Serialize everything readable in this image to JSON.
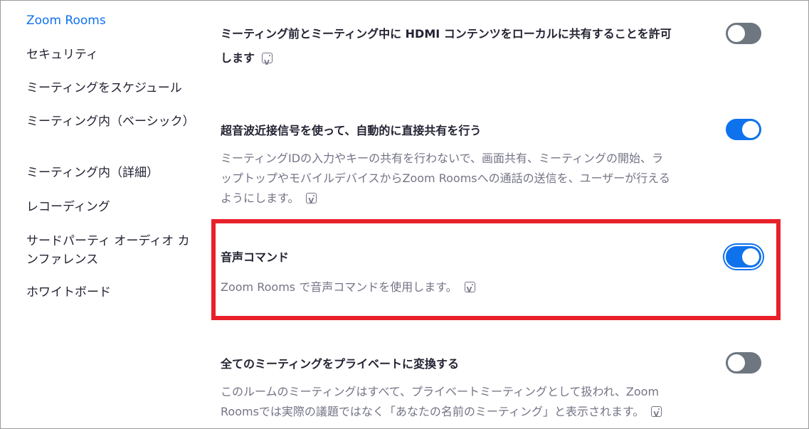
{
  "sidebar": {
    "items": [
      {
        "label": "Zoom Rooms",
        "active": true
      },
      {
        "label": "セキュリティ"
      },
      {
        "label": "ミーティングをスケジュール"
      },
      {
        "label": "ミーティング内（ベーシック）"
      },
      {
        "label": "ミーティング内（詳細）"
      },
      {
        "label": "レコーディング"
      },
      {
        "label": "サードパーティ オーディオ カンファレンス"
      },
      {
        "label": "ホワイトボード"
      }
    ]
  },
  "settings": [
    {
      "title_line1": "ミーティング前とミーティング中に HDMI コンテンツをローカルに共有することを許可",
      "title_line2": "します",
      "enabled": false
    },
    {
      "title": "超音波近接信号を使って、自動的に直接共有を行う",
      "desc_line1": "ミーティングIDの入力やキーの共有を行わないで、画面共有、ミーティングの開始、ラ",
      "desc_line2": "ップトップやモバイルデバイスからZoom Roomsへの通話の送信を、ユーザーが行える",
      "desc_line3": "ようにします。",
      "enabled": true
    },
    {
      "title": "音声コマンド",
      "desc": "Zoom Rooms で音声コマンドを使用します。",
      "enabled": true,
      "highlighted": true
    },
    {
      "title": "全てのミーティングをプライベートに変換する",
      "desc_line1": "このルームのミーティングはすべて、プライベートミーティングとして扱われ、Zoom",
      "desc_line2": "Roomsでは実際の議題ではなく「あなたの名前のミーティング」と表示されます。",
      "enabled": false
    }
  ],
  "colors": {
    "accent": "#0e72ed",
    "toggle_off": "#6e7680",
    "highlight": "#e8202a",
    "text": "#232333",
    "muted": "#747487"
  },
  "icons": {
    "info": "vb-info-icon"
  }
}
